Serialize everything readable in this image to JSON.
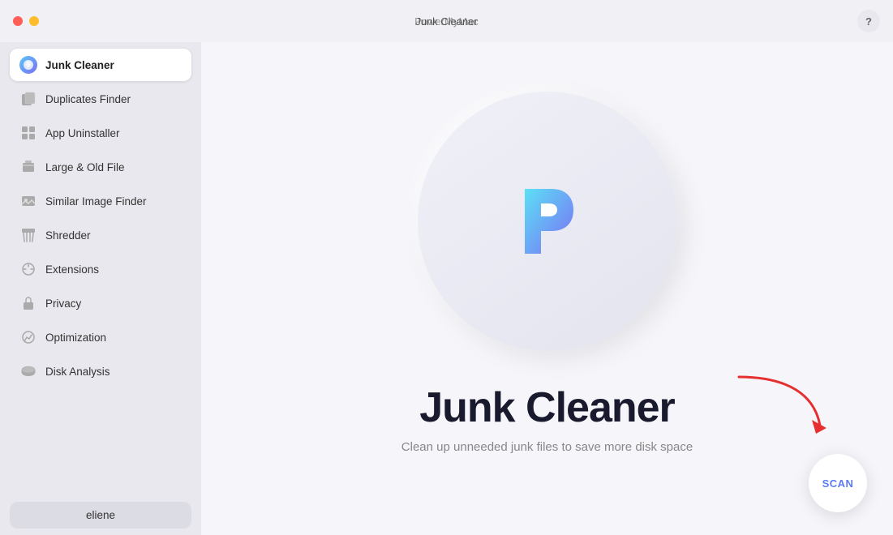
{
  "titlebar": {
    "app_name": "PowerMyMac",
    "window_title": "Junk Cleaner",
    "help_label": "?"
  },
  "sidebar": {
    "items": [
      {
        "id": "junk-cleaner",
        "label": "Junk Cleaner",
        "active": true
      },
      {
        "id": "duplicates-finder",
        "label": "Duplicates Finder",
        "active": false
      },
      {
        "id": "app-uninstaller",
        "label": "App Uninstaller",
        "active": false
      },
      {
        "id": "large-old-file",
        "label": "Large & Old File",
        "active": false
      },
      {
        "id": "similar-image-finder",
        "label": "Similar Image Finder",
        "active": false
      },
      {
        "id": "shredder",
        "label": "Shredder",
        "active": false
      },
      {
        "id": "extensions",
        "label": "Extensions",
        "active": false
      },
      {
        "id": "privacy",
        "label": "Privacy",
        "active": false
      },
      {
        "id": "optimization",
        "label": "Optimization",
        "active": false
      },
      {
        "id": "disk-analysis",
        "label": "Disk Analysis",
        "active": false
      }
    ],
    "user_label": "eliene"
  },
  "content": {
    "main_title": "Junk Cleaner",
    "subtitle": "Clean up unneeded junk files to save more disk space",
    "scan_label": "SCAN"
  }
}
